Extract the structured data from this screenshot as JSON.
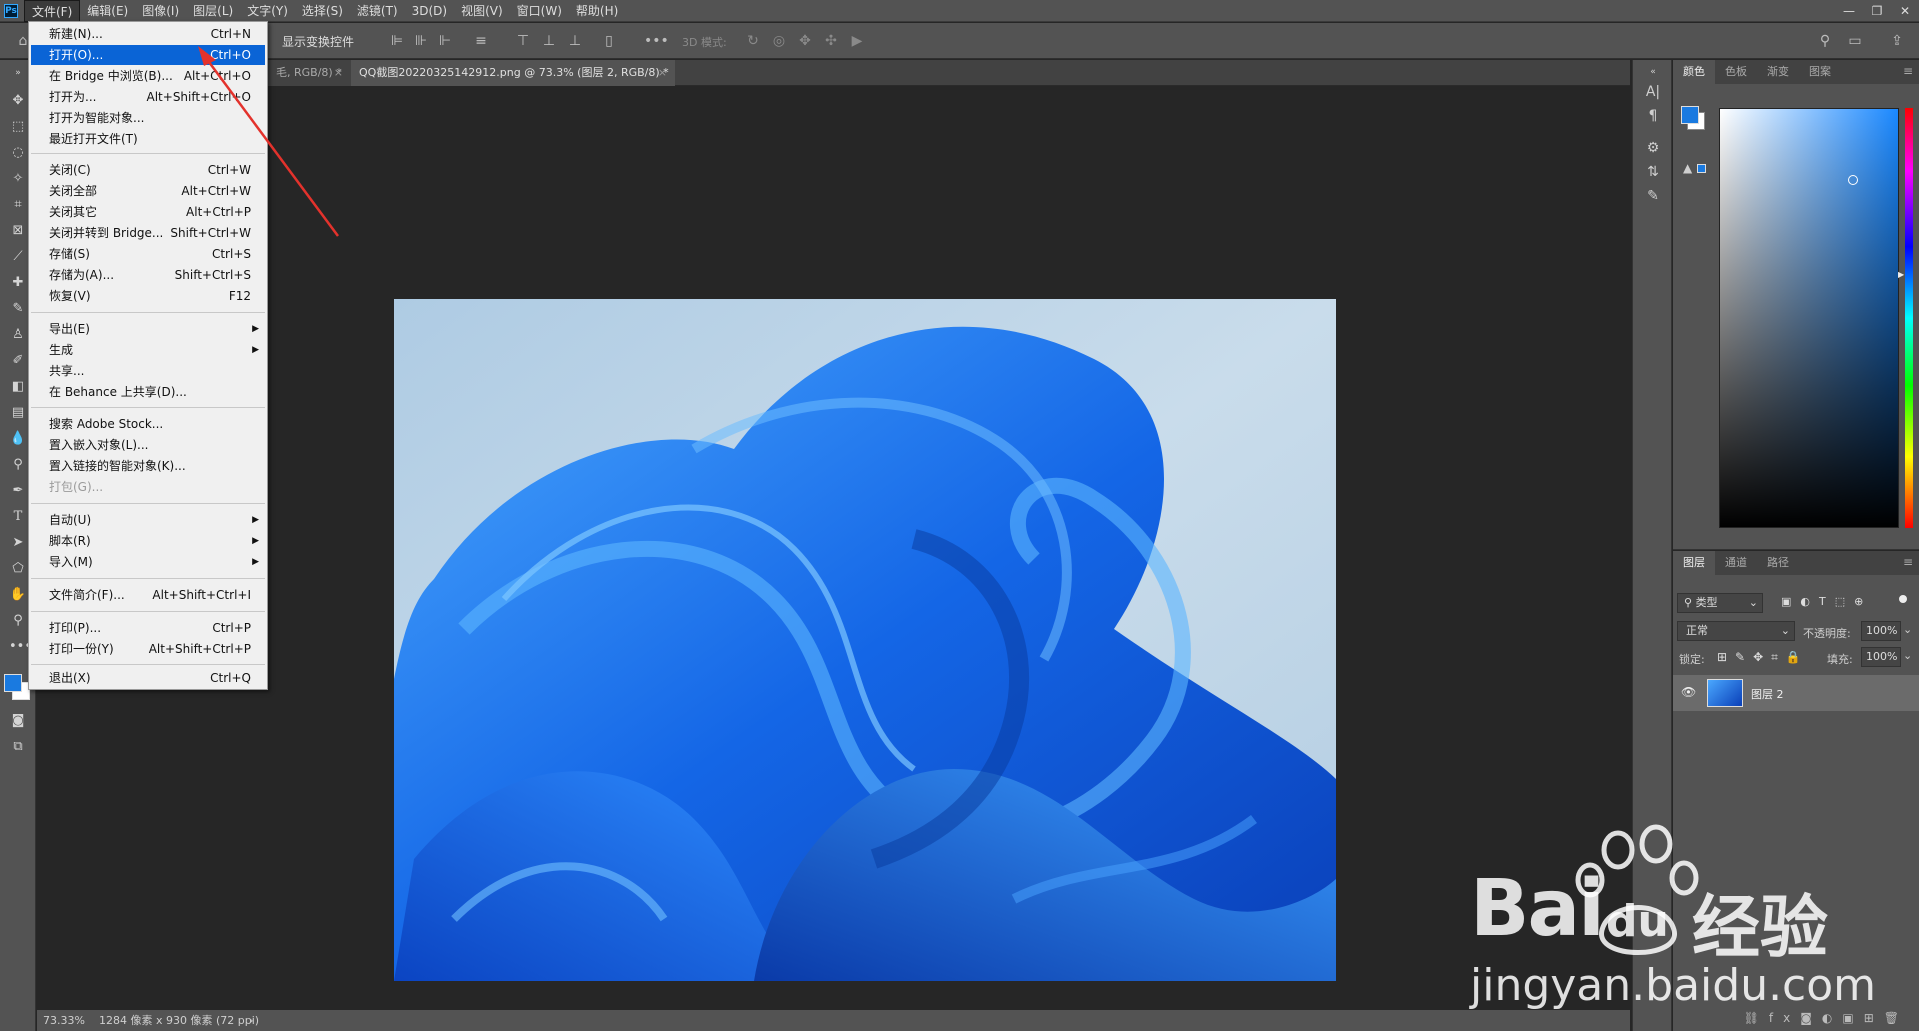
{
  "menubar": {
    "items": [
      "文件(F)",
      "编辑(E)",
      "图像(I)",
      "图层(L)",
      "文字(Y)",
      "选择(S)",
      "滤镜(T)",
      "3D(D)",
      "视图(V)",
      "窗口(W)",
      "帮助(H)"
    ]
  },
  "optbar": {
    "show_transform": "显示变换控件",
    "threed_mode": "3D 模式:"
  },
  "tabs": [
    {
      "label": "毛, RGB/8) *"
    },
    {
      "label": "QQ截图20220325142912.png @ 73.3% (图层 2, RGB/8) *"
    }
  ],
  "status": {
    "zoom": "73.33%",
    "doc_info": "1284 像素 x 930 像素 (72 ppi)"
  },
  "file_menu": {
    "items": [
      {
        "label": "新建(N)...",
        "shortcut": "Ctrl+N"
      },
      {
        "label": "打开(O)...",
        "shortcut": "Ctrl+O"
      },
      {
        "label": "在 Bridge 中浏览(B)...",
        "shortcut": "Alt+Ctrl+O"
      },
      {
        "label": "打开为...",
        "shortcut": "Alt+Shift+Ctrl+O"
      },
      {
        "label": "打开为智能对象...",
        "shortcut": ""
      },
      {
        "label": "最近打开文件(T)",
        "shortcut": ""
      },
      {
        "label": "关闭(C)",
        "shortcut": "Ctrl+W"
      },
      {
        "label": "关闭全部",
        "shortcut": "Alt+Ctrl+W"
      },
      {
        "label": "关闭其它",
        "shortcut": "Alt+Ctrl+P"
      },
      {
        "label": "关闭并转到 Bridge...",
        "shortcut": "Shift+Ctrl+W"
      },
      {
        "label": "存储(S)",
        "shortcut": "Ctrl+S"
      },
      {
        "label": "存储为(A)...",
        "shortcut": "Shift+Ctrl+S"
      },
      {
        "label": "恢复(V)",
        "shortcut": "F12"
      },
      {
        "label": "导出(E)",
        "shortcut": ""
      },
      {
        "label": "生成",
        "shortcut": ""
      },
      {
        "label": "共享...",
        "shortcut": ""
      },
      {
        "label": "在 Behance 上共享(D)...",
        "shortcut": ""
      },
      {
        "label": "搜索 Adobe Stock...",
        "shortcut": ""
      },
      {
        "label": "置入嵌入对象(L)...",
        "shortcut": ""
      },
      {
        "label": "置入链接的智能对象(K)...",
        "shortcut": ""
      },
      {
        "label": "打包(G)...",
        "shortcut": ""
      },
      {
        "label": "自动(U)",
        "shortcut": ""
      },
      {
        "label": "脚本(R)",
        "shortcut": ""
      },
      {
        "label": "导入(M)",
        "shortcut": ""
      },
      {
        "label": "文件简介(F)...",
        "shortcut": "Alt+Shift+Ctrl+I"
      },
      {
        "label": "打印(P)...",
        "shortcut": "Ctrl+P"
      },
      {
        "label": "打印一份(Y)",
        "shortcut": "Alt+Shift+Ctrl+P"
      },
      {
        "label": "退出(X)",
        "shortcut": "Ctrl+Q"
      }
    ]
  },
  "color_panel": {
    "tabs": [
      "颜色",
      "色板",
      "渐变",
      "图案"
    ],
    "foreground": "#1a7ae0",
    "background": "#ffffff"
  },
  "layers_panel": {
    "tabs": [
      "图层",
      "通道",
      "路径"
    ],
    "filter_kind": "类型",
    "blend_mode": "正常",
    "opacity_label": "不透明度:",
    "opacity": "100%",
    "lock_label": "锁定:",
    "fill_label": "填充:",
    "fill": "100%",
    "layer_name": "图层 2"
  },
  "watermark": {
    "brand": "Bai",
    "brand_du": "du",
    "brand_cn": "经验",
    "url": "jingyan.baidu.com"
  }
}
